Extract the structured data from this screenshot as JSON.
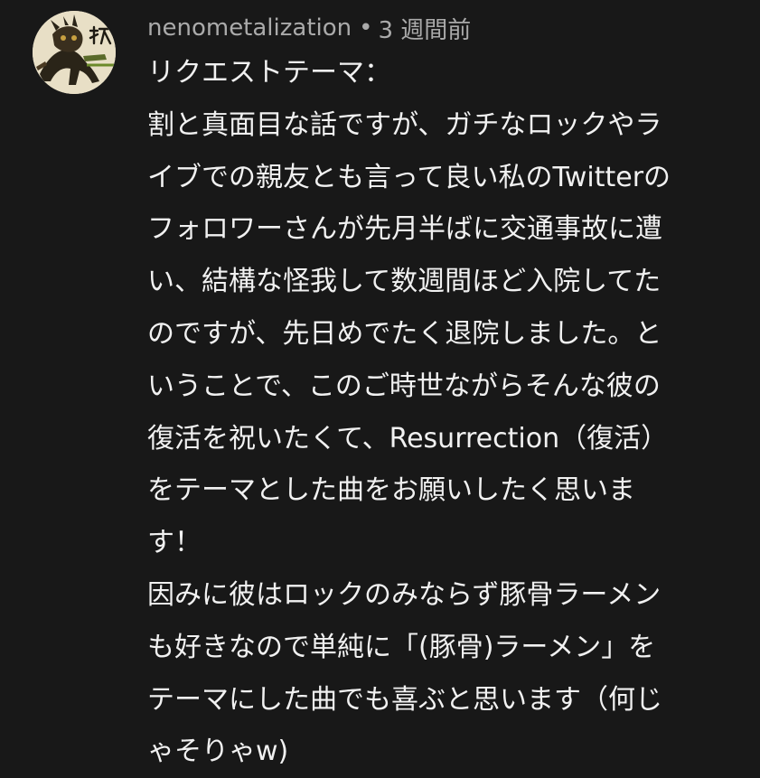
{
  "comment": {
    "author": "nenometalization",
    "separator": "•",
    "timestamp": "3 週間前",
    "avatar_icon": "avatar-icon",
    "lines": [
      "リクエストテーマ：",
      "割と真面目な話ですが、ガチなロックやラ",
      "イブでの親友とも言って良い私のTwitterの",
      "フォロワーさんが先月半ばに交通事故に遭",
      "い、結構な怪我して数週間ほど入院してた",
      "のですが、先日めでたく退院しました。と",
      "いうことで、このご時世ながらそんな彼の",
      "復活を祝いたくて、Resurrection（復活）",
      "をテーマとした曲をお願いしたく思いま",
      "す！",
      "因みに彼はロックのみならず豚骨ラーメン",
      "も好きなので単純に「(豚骨)ラーメン」を",
      "テーマにした曲でも喜ぶと思います（何じ",
      "ゃそりゃw)"
    ]
  },
  "colors": {
    "background": "#181818",
    "text": "#f1f1f1",
    "meta": "#aaaaaa"
  }
}
